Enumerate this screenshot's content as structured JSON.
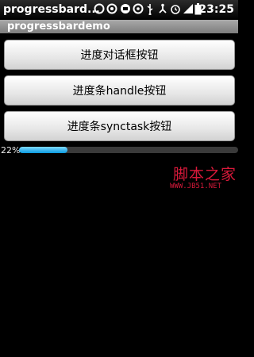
{
  "status_bar": {
    "app_label": "progressbard...",
    "time": "23:25",
    "icons": [
      "circle-icon",
      "circle-icon",
      "message-icon",
      "circle-icon",
      "usb-icon",
      "share-icon",
      "alarm-icon",
      "signal-icon",
      "battery-icon"
    ]
  },
  "title_bar": {
    "title": "progressbardemo"
  },
  "buttons": {
    "dialog": "进度对话框按钮",
    "handle": "进度条handle按钮",
    "synctask": "进度条synctask按钮"
  },
  "progress": {
    "percent_label": "22%",
    "value": 0.22
  },
  "watermark": {
    "top": "脚本之家",
    "sub": "WWW.JB51.NET"
  },
  "colors": {
    "accent": "#0a9be0",
    "watermark": "#d7193a"
  }
}
